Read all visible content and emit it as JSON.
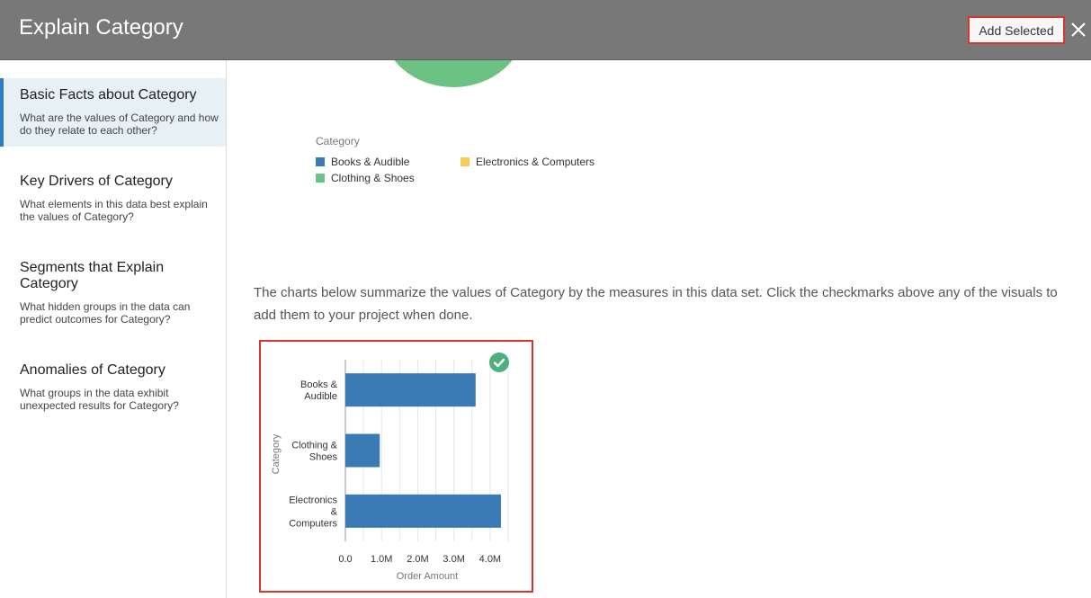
{
  "header": {
    "title": "Explain Category",
    "add_selected_label": "Add Selected"
  },
  "icons": {
    "close": "close-icon",
    "check": "checkmark-circle-icon"
  },
  "colors": {
    "header_bg": "#787878",
    "highlight": "#d9372b",
    "active_item_bg": "#e6f0f5",
    "active_accent": "#2f7bbf",
    "books": "#3a7ab5",
    "clothing": "#6cc282",
    "electronics": "#f4cf57",
    "check": "#4caf7d"
  },
  "sidebar": {
    "items": [
      {
        "title": "Basic Facts about Category",
        "desc": "What are the values of Category and how do they relate to each other?",
        "active": true
      },
      {
        "title": "Key Drivers of Category",
        "desc": "What elements in this data best explain the values of Category?"
      },
      {
        "title": "Segments that Explain Category",
        "desc": "What hidden groups in the data can predict outcomes for Category?"
      },
      {
        "title": "Anomalies of Category",
        "desc": "What groups in the data exhibit unexpected results for Category?"
      }
    ]
  },
  "legend": {
    "title": "Category",
    "items": [
      {
        "label": "Books & Audible",
        "color": "#3a7ab5"
      },
      {
        "label": "Electronics & Computers",
        "color": "#f4cf57"
      },
      {
        "label": "Clothing & Shoes",
        "color": "#6cc282"
      }
    ]
  },
  "summary_text": "The charts below summarize the values of Category by the measures in this data set. Click the checkmarks above any of the visuals to add them to your project when done.",
  "chart_data": {
    "type": "bar",
    "orientation": "horizontal",
    "categories": [
      "Books & Audible",
      "Clothing & Shoes",
      "Electronics & Computers"
    ],
    "category_lines": [
      [
        "Books &",
        "Audible"
      ],
      [
        "Clothing &",
        "Shoes"
      ],
      [
        "Electronics",
        "&",
        "Computers"
      ]
    ],
    "values": [
      3600000,
      950000,
      4300000
    ],
    "xlabel": "Order Amount",
    "ylabel": "Category",
    "xlim": [
      0,
      4500000
    ],
    "ticks": [
      0,
      1000000,
      2000000,
      3000000,
      4000000
    ],
    "tick_labels": [
      "0.0",
      "1.0M",
      "2.0M",
      "3.0M",
      "4.0M"
    ],
    "grid": true,
    "bar_color": "#3a7ab5"
  }
}
